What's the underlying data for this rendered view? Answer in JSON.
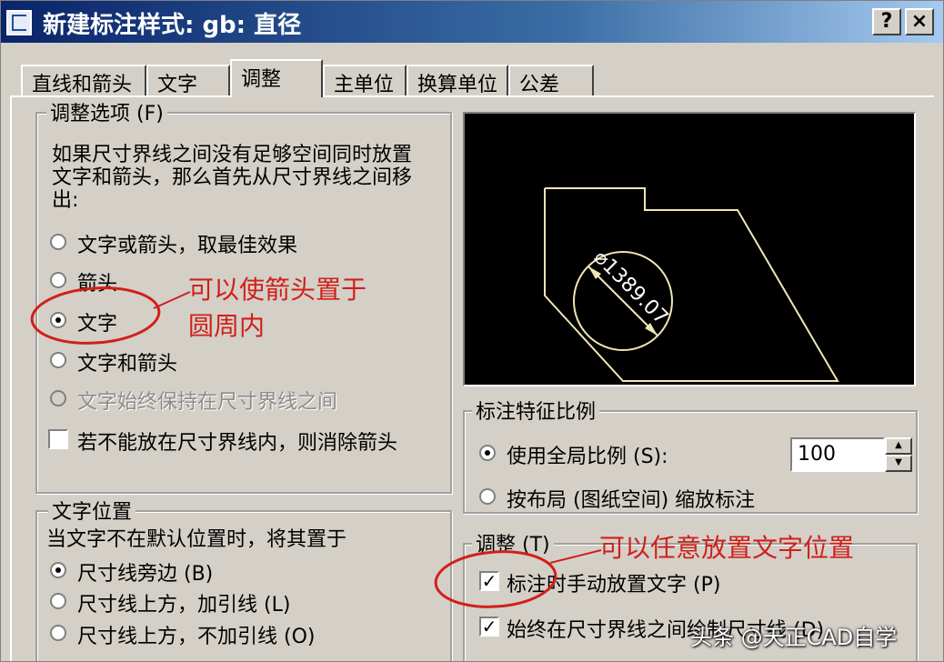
{
  "window": {
    "title": "新建标注样式: gb: 直径",
    "help_label": "?",
    "close_label": "×"
  },
  "tabs": [
    {
      "label": "直线和箭头"
    },
    {
      "label": "文字"
    },
    {
      "label": "调整",
      "active": true
    },
    {
      "label": "主单位"
    },
    {
      "label": "换算单位"
    },
    {
      "label": "公差"
    }
  ],
  "fit_options": {
    "legend": "调整选项 (F)",
    "description": [
      "如果尺寸界线之间没有足够空间同时放置",
      "文字和箭头，那么首先从尺寸界线之间移",
      "出:"
    ],
    "options": [
      {
        "label": "文字或箭头，取最佳效果",
        "selected": false,
        "disabled": false
      },
      {
        "label": "箭头",
        "selected": false,
        "disabled": false
      },
      {
        "label": "文字",
        "selected": true,
        "disabled": false
      },
      {
        "label": "文字和箭头",
        "selected": false,
        "disabled": false
      },
      {
        "label": "文字始终保持在尺寸界线之间",
        "selected": false,
        "disabled": true
      }
    ],
    "suppress_arrows": {
      "label": "若不能放在尺寸界线内，则消除箭头",
      "checked": false
    }
  },
  "text_placement": {
    "legend": "文字位置",
    "description": "当文字不在默认位置时，将其置于",
    "options": [
      {
        "label": "尺寸线旁边 (B)",
        "selected": true
      },
      {
        "label": "尺寸线上方，加引线 (L)",
        "selected": false
      },
      {
        "label": "尺寸线上方，不加引线 (O)",
        "selected": false
      }
    ]
  },
  "preview": {
    "dimension_text": "⌀1389.07",
    "background": "#000000",
    "line_color": "#f0e6b4"
  },
  "scale": {
    "legend": "标注特征比例",
    "use_overall": {
      "label": "使用全局比例 (S):",
      "selected": true
    },
    "overall_value": "100",
    "scale_to_layout": {
      "label": "按布局 (图纸空间) 缩放标注",
      "selected": false
    }
  },
  "fine_tuning": {
    "legend": "调整 (T)",
    "place_manually": {
      "label": "标注时手动放置文字 (P)",
      "checked": true
    },
    "always_draw": {
      "label": "始终在尺寸界线之间绘制尺寸线 (D)",
      "checked": true
    }
  },
  "annotations": {
    "note1_line1": "可以使箭头置于",
    "note1_line2": "圆周内",
    "note2": "可以任意放置文字位置",
    "color": "#d0201a"
  },
  "watermark": "头条 @天正CAD自学"
}
